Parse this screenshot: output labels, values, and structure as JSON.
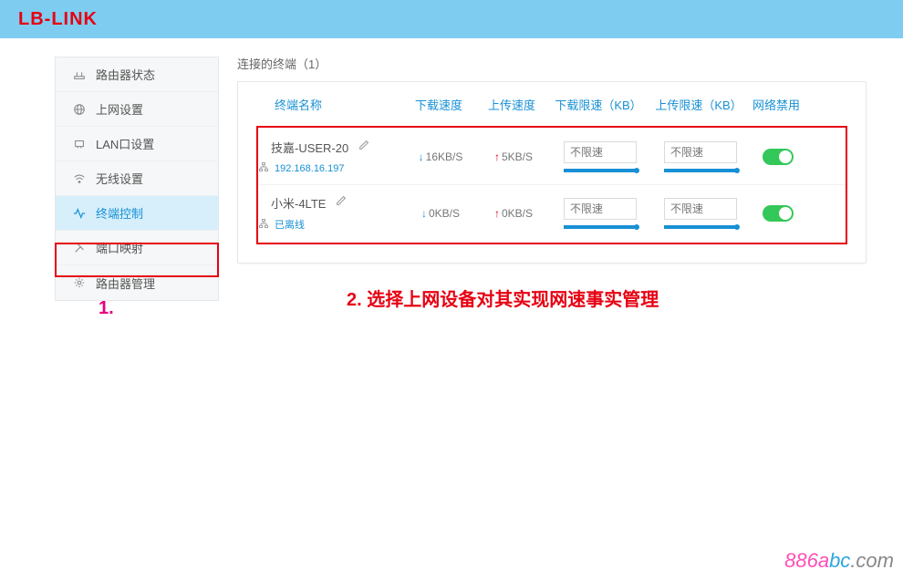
{
  "header": {
    "logo_prefix": "LB",
    "logo_suffix": "-LINK"
  },
  "sidebar": {
    "items": [
      {
        "label": "路由器状态"
      },
      {
        "label": "上网设置"
      },
      {
        "label": "LAN口设置"
      },
      {
        "label": "无线设置"
      },
      {
        "label": "终端控制"
      },
      {
        "label": "端口映射"
      },
      {
        "label": "路由器管理"
      }
    ],
    "active_index": 4
  },
  "content": {
    "section_title": "连接的终端（1）",
    "columns": {
      "name": "终端名称",
      "down": "下载速度",
      "up": "上传速度",
      "dlimit": "下载限速（KB）",
      "ulimit": "上传限速（KB）",
      "block": "网络禁用"
    },
    "devices": [
      {
        "name": "技嘉-USER-20",
        "sub": "192.168.16.197",
        "down_speed": "16KB/S",
        "up_speed": "5KB/S",
        "dlimit_placeholder": "不限速",
        "ulimit_placeholder": "不限速",
        "enabled": true
      },
      {
        "name": "小米-4LTE",
        "sub": "已离线",
        "down_speed": "0KB/S",
        "up_speed": "0KB/S",
        "dlimit_placeholder": "不限速",
        "ulimit_placeholder": "不限速",
        "enabled": true
      }
    ]
  },
  "annotations": {
    "one": "1.",
    "two": "2.  选择上网设备对其实现网速事实管理"
  },
  "watermark": {
    "a": "886a",
    "b": "bc",
    "c": ".com"
  },
  "colors": {
    "accent": "#1890d5",
    "danger": "#e60012",
    "toggle_on": "#34c759",
    "bg": "#7ecdf0"
  }
}
